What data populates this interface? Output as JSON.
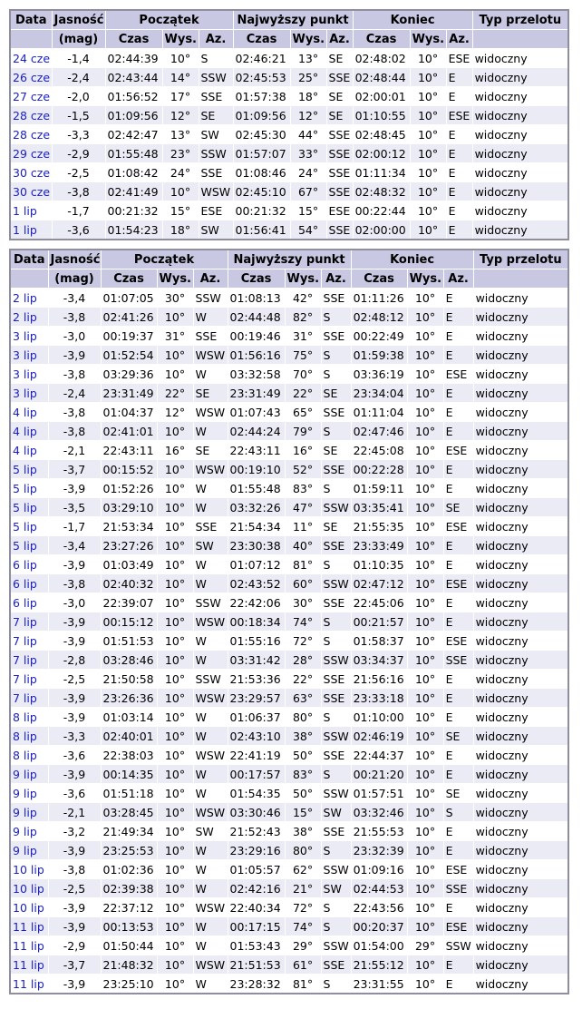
{
  "headers": {
    "date": "Data",
    "brightness": "Jasność",
    "mag": "(mag)",
    "start": "Początek",
    "highest": "Najwyższy punkt",
    "end": "Koniec",
    "pass_type": "Typ przelotu",
    "time": "Czas",
    "alt": "Wys.",
    "az": "Az."
  },
  "tables": [
    {
      "rows": [
        [
          "24 cze",
          "-1,4",
          "02:44:39",
          "10°",
          "S",
          "02:46:21",
          "13°",
          "SE",
          "02:48:02",
          "10°",
          "ESE",
          "widoczny"
        ],
        [
          "26 cze",
          "-2,4",
          "02:43:44",
          "14°",
          "SSW",
          "02:45:53",
          "25°",
          "SSE",
          "02:48:44",
          "10°",
          "E",
          "widoczny"
        ],
        [
          "27 cze",
          "-2,0",
          "01:56:52",
          "17°",
          "SSE",
          "01:57:38",
          "18°",
          "SE",
          "02:00:01",
          "10°",
          "E",
          "widoczny"
        ],
        [
          "28 cze",
          "-1,5",
          "01:09:56",
          "12°",
          "SE",
          "01:09:56",
          "12°",
          "SE",
          "01:10:55",
          "10°",
          "ESE",
          "widoczny"
        ],
        [
          "28 cze",
          "-3,3",
          "02:42:47",
          "13°",
          "SW",
          "02:45:30",
          "44°",
          "SSE",
          "02:48:45",
          "10°",
          "E",
          "widoczny"
        ],
        [
          "29 cze",
          "-2,9",
          "01:55:48",
          "23°",
          "SSW",
          "01:57:07",
          "33°",
          "SSE",
          "02:00:12",
          "10°",
          "E",
          "widoczny"
        ],
        [
          "30 cze",
          "-2,5",
          "01:08:42",
          "24°",
          "SSE",
          "01:08:46",
          "24°",
          "SSE",
          "01:11:34",
          "10°",
          "E",
          "widoczny"
        ],
        [
          "30 cze",
          "-3,8",
          "02:41:49",
          "10°",
          "WSW",
          "02:45:10",
          "67°",
          "SSE",
          "02:48:32",
          "10°",
          "E",
          "widoczny"
        ],
        [
          "1 lip",
          "-1,7",
          "00:21:32",
          "15°",
          "ESE",
          "00:21:32",
          "15°",
          "ESE",
          "00:22:44",
          "10°",
          "E",
          "widoczny"
        ],
        [
          "1 lip",
          "-3,6",
          "01:54:23",
          "18°",
          "SW",
          "01:56:41",
          "54°",
          "SSE",
          "02:00:00",
          "10°",
          "E",
          "widoczny"
        ]
      ]
    },
    {
      "rows": [
        [
          "2 lip",
          "-3,4",
          "01:07:05",
          "30°",
          "SSW",
          "01:08:13",
          "42°",
          "SSE",
          "01:11:26",
          "10°",
          "E",
          "widoczny"
        ],
        [
          "2 lip",
          "-3,8",
          "02:41:26",
          "10°",
          "W",
          "02:44:48",
          "82°",
          "S",
          "02:48:12",
          "10°",
          "E",
          "widoczny"
        ],
        [
          "3 lip",
          "-3,0",
          "00:19:37",
          "31°",
          "SSE",
          "00:19:46",
          "31°",
          "SSE",
          "00:22:49",
          "10°",
          "E",
          "widoczny"
        ],
        [
          "3 lip",
          "-3,9",
          "01:52:54",
          "10°",
          "WSW",
          "01:56:16",
          "75°",
          "S",
          "01:59:38",
          "10°",
          "E",
          "widoczny"
        ],
        [
          "3 lip",
          "-3,8",
          "03:29:36",
          "10°",
          "W",
          "03:32:58",
          "70°",
          "S",
          "03:36:19",
          "10°",
          "ESE",
          "widoczny"
        ],
        [
          "3 lip",
          "-2,4",
          "23:31:49",
          "22°",
          "SE",
          "23:31:49",
          "22°",
          "SE",
          "23:34:04",
          "10°",
          "E",
          "widoczny"
        ],
        [
          "4 lip",
          "-3,8",
          "01:04:37",
          "12°",
          "WSW",
          "01:07:43",
          "65°",
          "SSE",
          "01:11:04",
          "10°",
          "E",
          "widoczny"
        ],
        [
          "4 lip",
          "-3,8",
          "02:41:01",
          "10°",
          "W",
          "02:44:24",
          "79°",
          "S",
          "02:47:46",
          "10°",
          "E",
          "widoczny"
        ],
        [
          "4 lip",
          "-2,1",
          "22:43:11",
          "16°",
          "SE",
          "22:43:11",
          "16°",
          "SE",
          "22:45:08",
          "10°",
          "ESE",
          "widoczny"
        ],
        [
          "5 lip",
          "-3,7",
          "00:15:52",
          "10°",
          "WSW",
          "00:19:10",
          "52°",
          "SSE",
          "00:22:28",
          "10°",
          "E",
          "widoczny"
        ],
        [
          "5 lip",
          "-3,9",
          "01:52:26",
          "10°",
          "W",
          "01:55:48",
          "83°",
          "S",
          "01:59:11",
          "10°",
          "E",
          "widoczny"
        ],
        [
          "5 lip",
          "-3,5",
          "03:29:10",
          "10°",
          "W",
          "03:32:26",
          "47°",
          "SSW",
          "03:35:41",
          "10°",
          "SE",
          "widoczny"
        ],
        [
          "5 lip",
          "-1,7",
          "21:53:34",
          "10°",
          "SSE",
          "21:54:34",
          "11°",
          "SE",
          "21:55:35",
          "10°",
          "ESE",
          "widoczny"
        ],
        [
          "5 lip",
          "-3,4",
          "23:27:26",
          "10°",
          "SW",
          "23:30:38",
          "40°",
          "SSE",
          "23:33:49",
          "10°",
          "E",
          "widoczny"
        ],
        [
          "6 lip",
          "-3,9",
          "01:03:49",
          "10°",
          "W",
          "01:07:12",
          "81°",
          "S",
          "01:10:35",
          "10°",
          "E",
          "widoczny"
        ],
        [
          "6 lip",
          "-3,8",
          "02:40:32",
          "10°",
          "W",
          "02:43:52",
          "60°",
          "SSW",
          "02:47:12",
          "10°",
          "ESE",
          "widoczny"
        ],
        [
          "6 lip",
          "-3,0",
          "22:39:07",
          "10°",
          "SSW",
          "22:42:06",
          "30°",
          "SSE",
          "22:45:06",
          "10°",
          "E",
          "widoczny"
        ],
        [
          "7 lip",
          "-3,9",
          "00:15:12",
          "10°",
          "WSW",
          "00:18:34",
          "74°",
          "S",
          "00:21:57",
          "10°",
          "E",
          "widoczny"
        ],
        [
          "7 lip",
          "-3,9",
          "01:51:53",
          "10°",
          "W",
          "01:55:16",
          "72°",
          "S",
          "01:58:37",
          "10°",
          "ESE",
          "widoczny"
        ],
        [
          "7 lip",
          "-2,8",
          "03:28:46",
          "10°",
          "W",
          "03:31:42",
          "28°",
          "SSW",
          "03:34:37",
          "10°",
          "SSE",
          "widoczny"
        ],
        [
          "7 lip",
          "-2,5",
          "21:50:58",
          "10°",
          "SSW",
          "21:53:36",
          "22°",
          "SSE",
          "21:56:16",
          "10°",
          "E",
          "widoczny"
        ],
        [
          "7 lip",
          "-3,9",
          "23:26:36",
          "10°",
          "WSW",
          "23:29:57",
          "63°",
          "SSE",
          "23:33:18",
          "10°",
          "E",
          "widoczny"
        ],
        [
          "8 lip",
          "-3,9",
          "01:03:14",
          "10°",
          "W",
          "01:06:37",
          "80°",
          "S",
          "01:10:00",
          "10°",
          "E",
          "widoczny"
        ],
        [
          "8 lip",
          "-3,3",
          "02:40:01",
          "10°",
          "W",
          "02:43:10",
          "38°",
          "SSW",
          "02:46:19",
          "10°",
          "SE",
          "widoczny"
        ],
        [
          "8 lip",
          "-3,6",
          "22:38:03",
          "10°",
          "WSW",
          "22:41:19",
          "50°",
          "SSE",
          "22:44:37",
          "10°",
          "E",
          "widoczny"
        ],
        [
          "9 lip",
          "-3,9",
          "00:14:35",
          "10°",
          "W",
          "00:17:57",
          "83°",
          "S",
          "00:21:20",
          "10°",
          "E",
          "widoczny"
        ],
        [
          "9 lip",
          "-3,6",
          "01:51:18",
          "10°",
          "W",
          "01:54:35",
          "50°",
          "SSW",
          "01:57:51",
          "10°",
          "SE",
          "widoczny"
        ],
        [
          "9 lip",
          "-2,1",
          "03:28:45",
          "10°",
          "WSW",
          "03:30:46",
          "15°",
          "SW",
          "03:32:46",
          "10°",
          "S",
          "widoczny"
        ],
        [
          "9 lip",
          "-3,2",
          "21:49:34",
          "10°",
          "SW",
          "21:52:43",
          "38°",
          "SSE",
          "21:55:53",
          "10°",
          "E",
          "widoczny"
        ],
        [
          "9 lip",
          "-3,9",
          "23:25:53",
          "10°",
          "W",
          "23:29:16",
          "80°",
          "S",
          "23:32:39",
          "10°",
          "E",
          "widoczny"
        ],
        [
          "10 lip",
          "-3,8",
          "01:02:36",
          "10°",
          "W",
          "01:05:57",
          "62°",
          "SSW",
          "01:09:16",
          "10°",
          "ESE",
          "widoczny"
        ],
        [
          "10 lip",
          "-2,5",
          "02:39:38",
          "10°",
          "W",
          "02:42:16",
          "21°",
          "SW",
          "02:44:53",
          "10°",
          "SSE",
          "widoczny"
        ],
        [
          "10 lip",
          "-3,9",
          "22:37:12",
          "10°",
          "WSW",
          "22:40:34",
          "72°",
          "S",
          "22:43:56",
          "10°",
          "E",
          "widoczny"
        ],
        [
          "11 lip",
          "-3,9",
          "00:13:53",
          "10°",
          "W",
          "00:17:15",
          "74°",
          "S",
          "00:20:37",
          "10°",
          "ESE",
          "widoczny"
        ],
        [
          "11 lip",
          "-2,9",
          "01:50:44",
          "10°",
          "W",
          "01:53:43",
          "29°",
          "SSW",
          "01:54:00",
          "29°",
          "SSW",
          "widoczny"
        ],
        [
          "11 lip",
          "-3,7",
          "21:48:32",
          "10°",
          "WSW",
          "21:51:53",
          "61°",
          "SSE",
          "21:55:12",
          "10°",
          "E",
          "widoczny"
        ],
        [
          "11 lip",
          "-3,9",
          "23:25:10",
          "10°",
          "W",
          "23:28:32",
          "81°",
          "S",
          "23:31:55",
          "10°",
          "E",
          "widoczny"
        ]
      ]
    }
  ]
}
